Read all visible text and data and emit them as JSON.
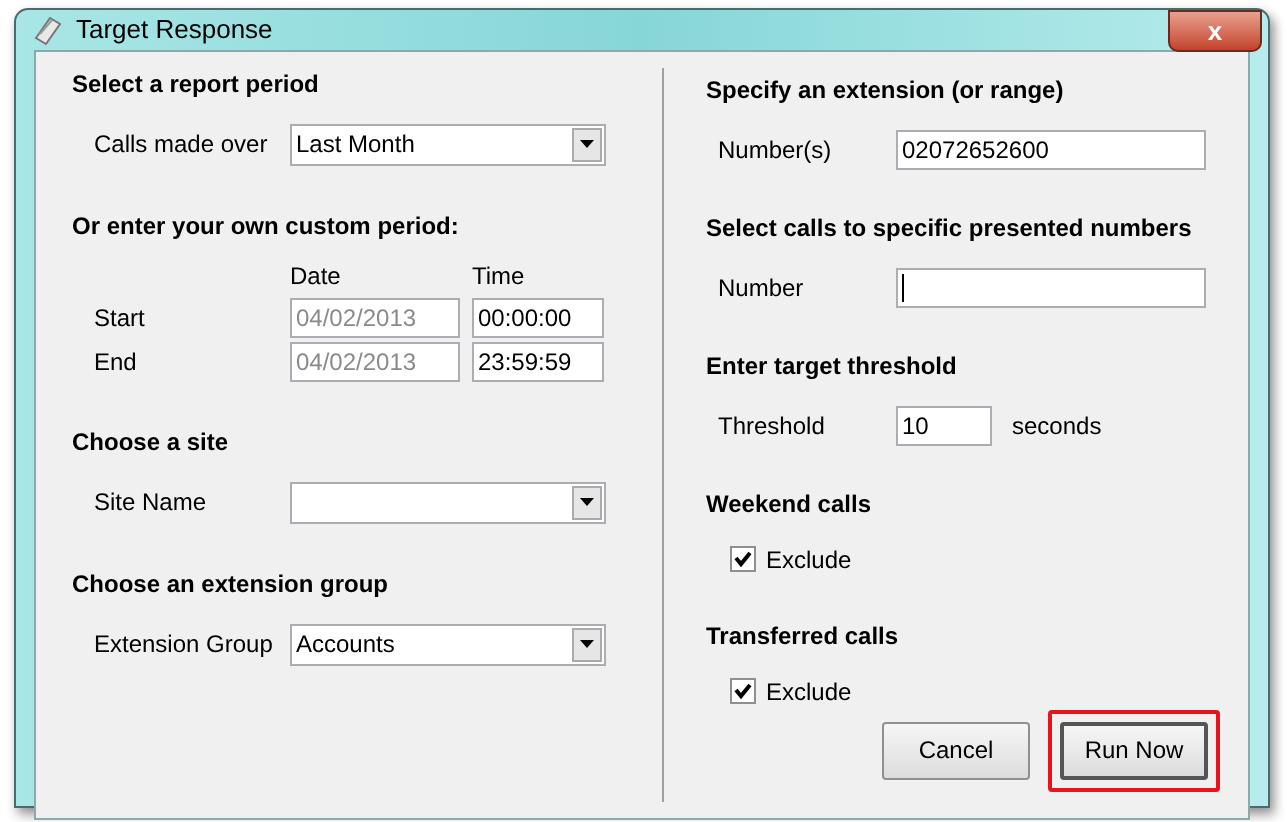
{
  "window": {
    "title": "Target Response",
    "close_label": "x"
  },
  "left_sections": [
    {
      "heading": "Select a report period",
      "rows": [
        {
          "kind": "dropdown",
          "label": "Calls made over",
          "value": "Last Month"
        }
      ]
    },
    {
      "heading": "Or enter your own custom period:",
      "rows": [
        {
          "kind": "header",
          "date_label": "Date",
          "time_label": "Time"
        },
        {
          "kind": "datetime",
          "label": "Start",
          "date": "04/02/2013",
          "date_disabled": true,
          "time": "00:00:00"
        },
        {
          "kind": "datetime",
          "label": "End",
          "date": "04/02/2013",
          "date_disabled": true,
          "time": "23:59:59"
        }
      ]
    },
    {
      "heading": "Choose a site",
      "rows": [
        {
          "kind": "dropdown",
          "label": "Site Name",
          "value": ""
        }
      ]
    },
    {
      "heading": "Choose an extension group",
      "rows": [
        {
          "kind": "dropdown",
          "label": "Extension Group",
          "value": "Accounts"
        }
      ]
    }
  ],
  "right_sections": [
    {
      "heading": "Specify an extension (or range)",
      "rows": [
        {
          "kind": "text",
          "label": "Number(s)",
          "value": "02072652600",
          "focused": false
        }
      ]
    },
    {
      "heading": "Select calls to specific presented numbers",
      "rows": [
        {
          "kind": "text",
          "label": "Number",
          "value": "",
          "focused": true
        }
      ]
    },
    {
      "heading": "Enter target threshold",
      "rows": [
        {
          "kind": "threshold",
          "label": "Threshold",
          "value": "10",
          "unit": "seconds"
        }
      ]
    },
    {
      "heading": "Weekend calls",
      "rows": [
        {
          "kind": "checkbox",
          "label": "Exclude",
          "checked": true
        }
      ]
    },
    {
      "heading": "Transferred calls",
      "rows": [
        {
          "kind": "checkbox",
          "label": "Exclude",
          "checked": true
        }
      ]
    }
  ],
  "buttons": [
    {
      "label": "Cancel",
      "highlighted": false
    },
    {
      "label": "Run Now",
      "highlighted": true
    }
  ]
}
